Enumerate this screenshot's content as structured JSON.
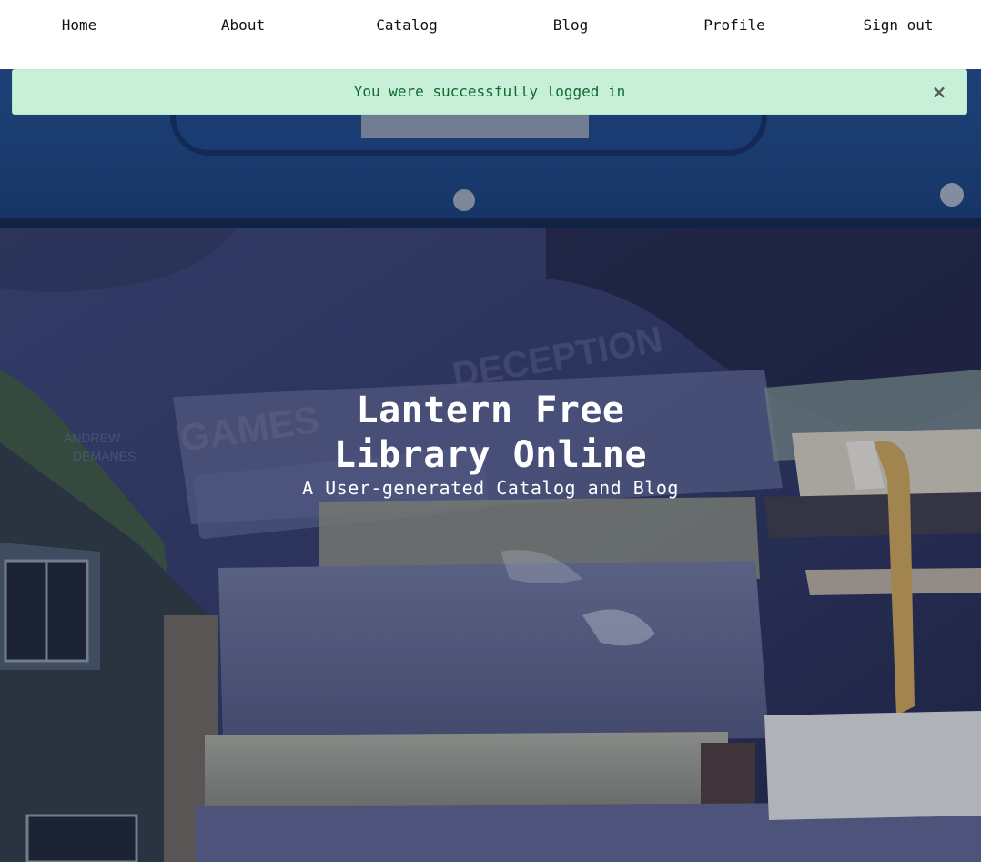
{
  "nav": {
    "items": [
      {
        "label": "Home"
      },
      {
        "label": "About"
      },
      {
        "label": "Catalog"
      },
      {
        "label": "Blog"
      },
      {
        "label": "Profile"
      },
      {
        "label": "Sign out"
      }
    ]
  },
  "alert": {
    "message": "You were successfully logged in",
    "close_symbol": "×",
    "close_icon": "close-icon",
    "color": "#c8f0d8"
  },
  "hero": {
    "title_line1": "Lantern Free",
    "title_line2": "Library Online",
    "subtitle": "A User-generated Catalog and Blog"
  }
}
